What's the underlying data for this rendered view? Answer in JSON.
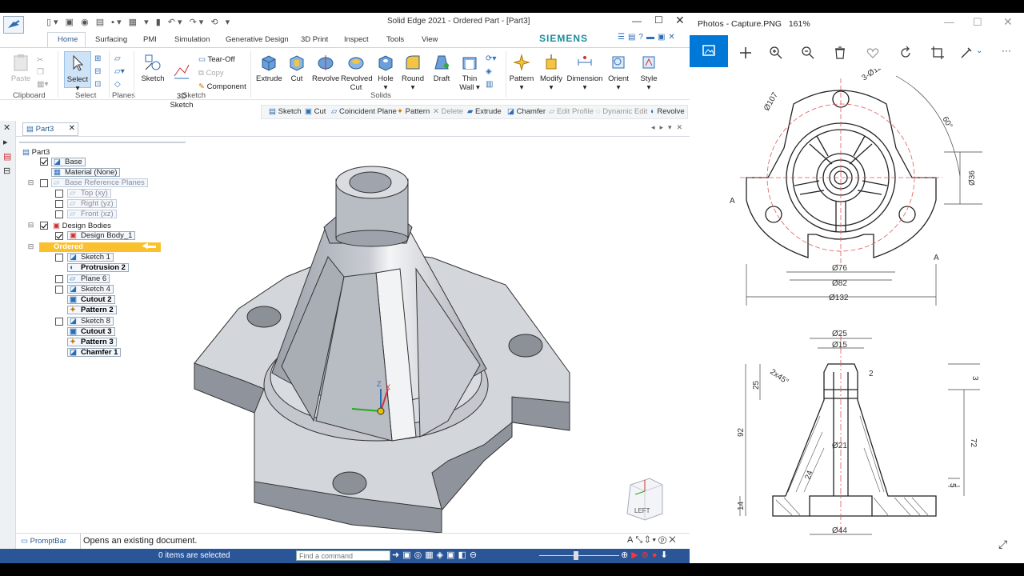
{
  "solid_edge": {
    "title": "Solid Edge 2021 - Ordered Part - [Part3]",
    "brand": "SIEMENS",
    "tabs": [
      "Home",
      "Surfacing",
      "PMI",
      "Simulation",
      "Generative Design",
      "3D Print",
      "Inspect",
      "Tools",
      "View"
    ],
    "ribbon": {
      "paste": "Paste",
      "clipboard_group": "Clipboard",
      "select": "Select",
      "select_group": "Select",
      "planes_group": "Planes",
      "sketch": "Sketch",
      "sketch3d": "3D\nSketch",
      "tearoff": "Tear-Off",
      "copy": "Copy",
      "component": "Component",
      "sketch_group": "Sketch",
      "extrude": "Extrude",
      "cut": "Cut",
      "revolve": "Revolve",
      "revolved_cut_1": "Revolved",
      "revolved_cut_2": "Cut",
      "hole": "Hole",
      "round": "Round",
      "draft": "Draft",
      "thinwall_1": "Thin",
      "thinwall_2": "Wall",
      "solids_group": "Solids",
      "pattern": "Pattern",
      "modify": "Modify",
      "dimension": "Dimension",
      "orient": "Orient",
      "style": "Style"
    },
    "command_bar": [
      "Sketch",
      "Cut",
      "Coincident Plane",
      "Pattern",
      "Delete",
      "Extrude",
      "Chamfer",
      "Edit Profile",
      "Dynamic Edit",
      "Revolve"
    ],
    "doc_tab": "Part3",
    "tree": {
      "root": "Part3",
      "base": "Base",
      "material": "Material (None)",
      "base_ref_planes": "Base Reference Planes",
      "top": "Top (xy)",
      "right": "Right (yz)",
      "front": "Front (xz)",
      "design_bodies": "Design Bodies",
      "design_body_1": "Design Body_1",
      "ordered": "Ordered",
      "items": [
        "Sketch 1",
        "Protrusion 2",
        "Plane 6",
        "Sketch 4",
        "Cutout 2",
        "Pattern 2",
        "Sketch 8",
        "Cutout 3",
        "Pattern 3",
        "Chamfer 1"
      ]
    },
    "view_cube_label": "LEFT",
    "prompt_bar_label": "PromptBar",
    "prompt_text": "Opens an existing document.",
    "status_text": "0 items are selected",
    "find_command_placeholder": "Find a command"
  },
  "photos": {
    "title": "Photos - Capture.PNG",
    "zoom": "161%"
  },
  "drawing": {
    "top_labels": [
      "3-Ø12",
      "Ø107",
      "Ø36",
      "60°",
      "Ø76",
      "Ø82",
      "Ø132",
      "A",
      "A"
    ],
    "section_labels": [
      "Ø25",
      "Ø15",
      "2x45°",
      "2",
      "3",
      "25",
      "92",
      "72",
      "Ø21",
      "5",
      "14",
      "Ø44",
      "24"
    ]
  }
}
